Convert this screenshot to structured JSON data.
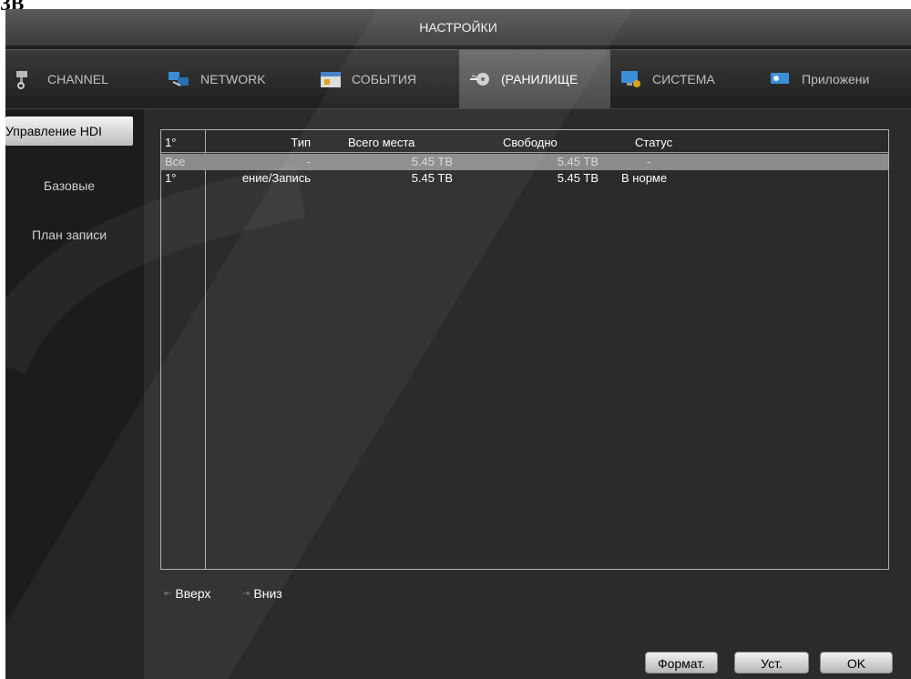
{
  "page_label": "ЗВ",
  "window": {
    "title": "НАСТРОЙКИ"
  },
  "tabs": [
    {
      "label": "CHANNEL",
      "icon": "camera-icon"
    },
    {
      "label": "NETWORK",
      "icon": "network-icon"
    },
    {
      "label": "СОБЫТИЯ",
      "icon": "calendar-icon"
    },
    {
      "label": "(РАНИЛИЩЕ",
      "icon": "storage-icon",
      "active": true
    },
    {
      "label": "СИСТЕМА",
      "icon": "system-icon"
    },
    {
      "label": "Приложени",
      "icon": "apps-icon"
    }
  ],
  "sidebar": {
    "items": [
      {
        "label": "Управление HDI",
        "active": true
      },
      {
        "label": "Базовые"
      },
      {
        "label": "План записи"
      }
    ]
  },
  "table": {
    "headers": [
      "1°",
      "Тип",
      "Всего места",
      "Свободно",
      "Статус"
    ],
    "rows": [
      [
        "Все",
        "-",
        "5.45 TB",
        "5.45 TB",
        "-"
      ],
      [
        "1°",
        "ение/Запись",
        "5.45 TB",
        "5.45 TB",
        "В норме"
      ]
    ]
  },
  "nav": {
    "up": "Вверх",
    "down": "Вниз"
  },
  "buttons": {
    "format": "Формат.",
    "set": "Уст.",
    "ok": "OK"
  },
  "colors": {
    "active_tab": "#5a5a5a",
    "selected_row": "#8b8b8b",
    "background": "#2b2b2b"
  }
}
